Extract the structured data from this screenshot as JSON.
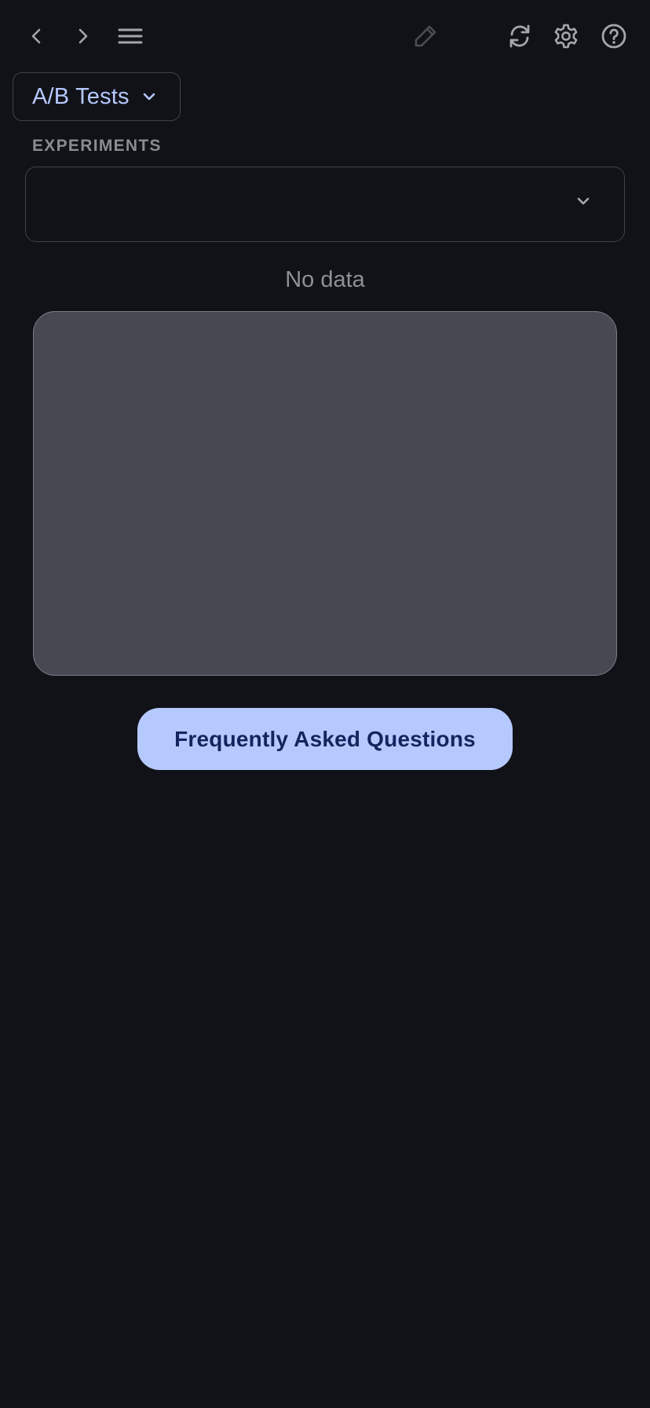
{
  "toolbar": {
    "back_icon": "chevron-left-icon",
    "forward_icon": "chevron-right-icon",
    "menu_icon": "hamburger-menu-icon",
    "edit_icon": "pencil-icon",
    "refresh_icon": "refresh-icon",
    "settings_icon": "gear-icon",
    "help_icon": "help-circle-icon"
  },
  "section_selector": {
    "label": "A/B Tests"
  },
  "experiments": {
    "label": "EXPERIMENTS",
    "selected_value": ""
  },
  "empty_state": {
    "text": "No data"
  },
  "faq": {
    "label": "Frequently Asked Questions"
  },
  "colors": {
    "background": "#111218",
    "accent": "#b6c9ff",
    "accent_text": "#13255e",
    "card": "#464952",
    "muted_text": "#8e9097"
  }
}
